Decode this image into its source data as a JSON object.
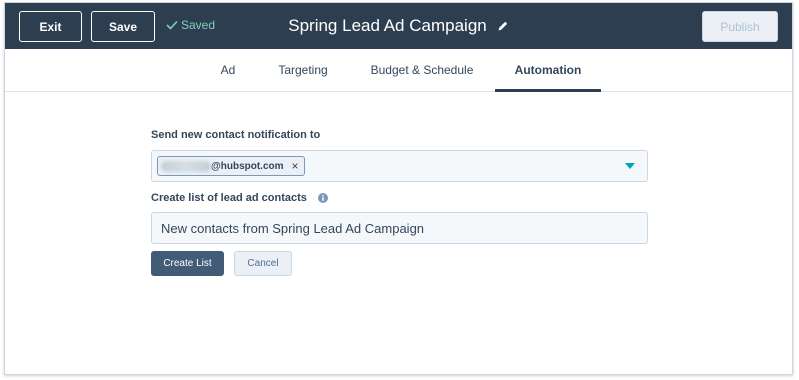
{
  "header": {
    "exit_label": "Exit",
    "save_label": "Save",
    "saved_status": "Saved",
    "title": "Spring Lead Ad Campaign",
    "publish_label": "Publish"
  },
  "tabs": [
    {
      "label": "Ad",
      "active": false
    },
    {
      "label": "Targeting",
      "active": false
    },
    {
      "label": "Budget & Schedule",
      "active": false
    },
    {
      "label": "Automation",
      "active": true
    }
  ],
  "form": {
    "notify_label": "Send new contact notification to",
    "notify_chip_domain": "@hubspot.com",
    "notify_chip_remove": "×",
    "list_label": "Create list of lead ad contacts",
    "list_value": "New contacts from Spring Lead Ad Campaign",
    "create_label": "Create List",
    "cancel_label": "Cancel"
  },
  "colors": {
    "header_bg": "#2d3e50",
    "saved_green": "#7fd1b9",
    "caret_teal": "#00a4bd",
    "primary_button": "#425b76"
  },
  "icons": [
    "check-icon",
    "pencil-icon",
    "info-icon",
    "chevron-down-icon",
    "close-icon"
  ]
}
